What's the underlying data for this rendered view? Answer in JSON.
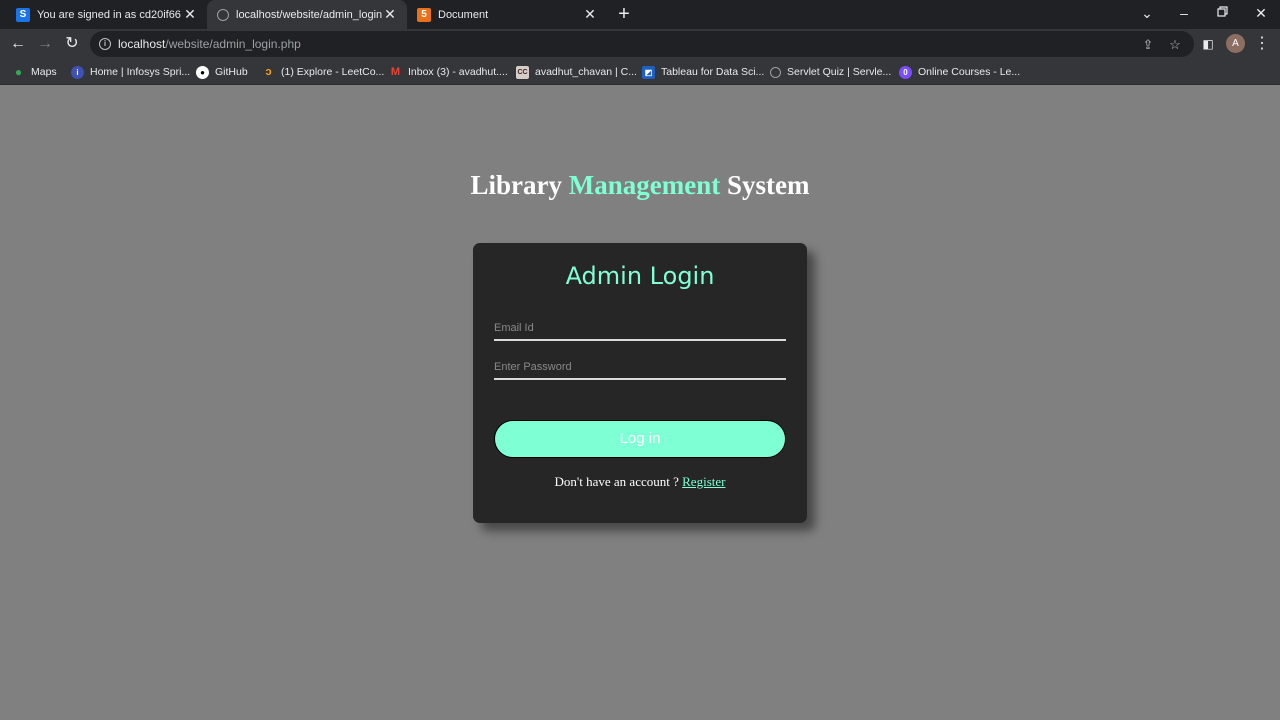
{
  "browser": {
    "tabs": [
      {
        "title": "You are signed in as cd20if66",
        "favicon": "S",
        "favicon_color": "#1a73e8",
        "active": false
      },
      {
        "title": "localhost/website/admin_login.php",
        "favicon": "globe",
        "favicon_color": "#5f6368",
        "active": true
      },
      {
        "title": "Document",
        "favicon": "html5",
        "favicon_color": "#e8711a",
        "active": false
      }
    ],
    "new_tab_label": "+",
    "url_host": "localhost",
    "url_path": "/website/admin_login.php",
    "profile_initial": "A",
    "bookmarks": [
      {
        "label": "Maps",
        "icon": "maps-icon",
        "color": "#34a853"
      },
      {
        "label": "Home | Infosys Spri...",
        "icon": "infosys-icon",
        "color": "#3f51b5"
      },
      {
        "label": "GitHub",
        "icon": "github-icon",
        "color": "#ffffff"
      },
      {
        "label": "(1) Explore - LeetCo...",
        "icon": "leetcode-icon",
        "color": "#ffa116"
      },
      {
        "label": "Inbox (3) - avadhut....",
        "icon": "gmail-icon",
        "color": "#ea4335"
      },
      {
        "label": "avadhut_chavan | C...",
        "icon": "codechef-icon",
        "color": "#5b4638"
      },
      {
        "label": "Tableau for Data Sci...",
        "icon": "tableau-icon",
        "color": "#1f5fbf"
      },
      {
        "label": "Servlet Quiz | Servle...",
        "icon": "globe-icon",
        "color": "#9aa0a6"
      },
      {
        "label": "Online Courses - Le...",
        "icon": "courses-icon",
        "color": "#7c4dff"
      }
    ]
  },
  "page": {
    "heading_part1": "Library ",
    "heading_accent": "Management",
    "heading_part2": " System",
    "card_title": "Admin Login",
    "email_placeholder": "Email Id",
    "password_placeholder": "Enter Password",
    "login_label": "Log in",
    "register_prompt": "Don't have an account ? ",
    "register_link": "Register"
  },
  "colors": {
    "accent": "#7fffd4",
    "page_background": "#808080",
    "card_background": "#262626"
  }
}
